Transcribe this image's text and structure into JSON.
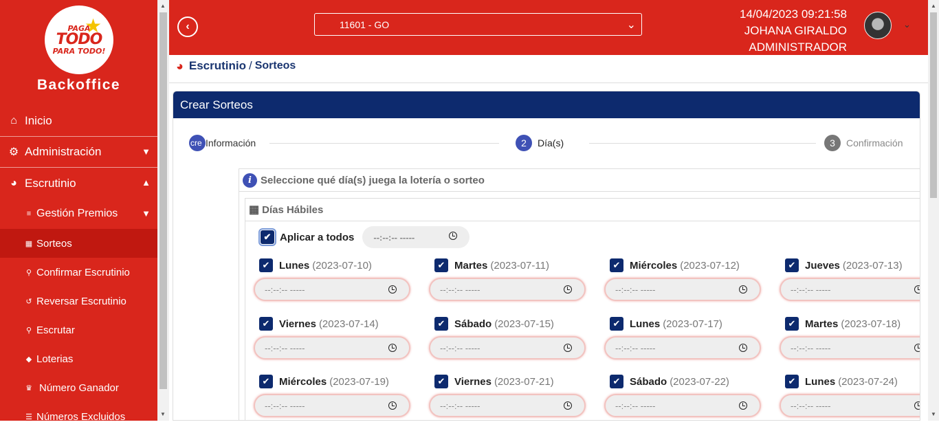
{
  "sidebar": {
    "logo": {
      "line1": "PAGA",
      "line2": "TODO",
      "line3": "PARA TODO!"
    },
    "brand": "Backoffice",
    "items": [
      {
        "label": "Inicio",
        "icon": "home-icon"
      },
      {
        "label": "Administración",
        "icon": "gear-icon"
      },
      {
        "label": "Escrutinio",
        "icon": "pie-chart-icon"
      }
    ],
    "subitems": [
      {
        "label": "Gestión Premios",
        "icon": "sliders-icon"
      },
      {
        "label": "Sorteos",
        "icon": "calendar-icon"
      },
      {
        "label": "Confirmar Escrutinio",
        "icon": "search-icon"
      },
      {
        "label": "Reversar Escrutinio",
        "icon": "undo-icon"
      },
      {
        "label": "Escrutar",
        "icon": "search-icon"
      },
      {
        "label": "Loterias",
        "icon": "ticket-icon"
      },
      {
        "label": "Número Ganador",
        "icon": "trophy-icon"
      },
      {
        "label": "Números Excluidos",
        "icon": "list-icon"
      }
    ]
  },
  "topbar": {
    "site": "11601 - GO",
    "datetime": "14/04/2023 09:21:58",
    "user_name": "JOHANA GIRALDO",
    "role": "ADMINISTRADOR"
  },
  "breadcrumb": {
    "section": "Escrutinio",
    "sep": "/",
    "page": "Sorteos"
  },
  "card": {
    "title": "Crear Sorteos",
    "steps": [
      {
        "num": "cre",
        "label": "Información"
      },
      {
        "num": "2",
        "label": "Día(s)"
      },
      {
        "num": "3",
        "label": "Confirmación"
      }
    ],
    "panel_title": "Seleccione qué día(s) juega la lotería o sorteo",
    "inner_title": "Días Hábiles",
    "apply_all": "Aplicar a todos",
    "time_placeholder": "--:--:-- -----",
    "days": [
      {
        "name": "Lunes",
        "date": "(2023-07-10)"
      },
      {
        "name": "Martes",
        "date": "(2023-07-11)"
      },
      {
        "name": "Miércoles",
        "date": "(2023-07-12)"
      },
      {
        "name": "Jueves",
        "date": "(2023-07-13)"
      },
      {
        "name": "Viernes",
        "date": "(2023-07-14)"
      },
      {
        "name": "Sábado",
        "date": "(2023-07-15)"
      },
      {
        "name": "Lunes",
        "date": "(2023-07-17)"
      },
      {
        "name": "Martes",
        "date": "(2023-07-18)"
      },
      {
        "name": "Miércoles",
        "date": "(2023-07-19)"
      },
      {
        "name": "Viernes",
        "date": "(2023-07-21)"
      },
      {
        "name": "Sábado",
        "date": "(2023-07-22)"
      },
      {
        "name": "Lunes",
        "date": "(2023-07-24)"
      }
    ]
  },
  "colors": {
    "brand_red": "#d9261c",
    "navy": "#0d2a6e",
    "step_blue": "#3f51b5"
  }
}
